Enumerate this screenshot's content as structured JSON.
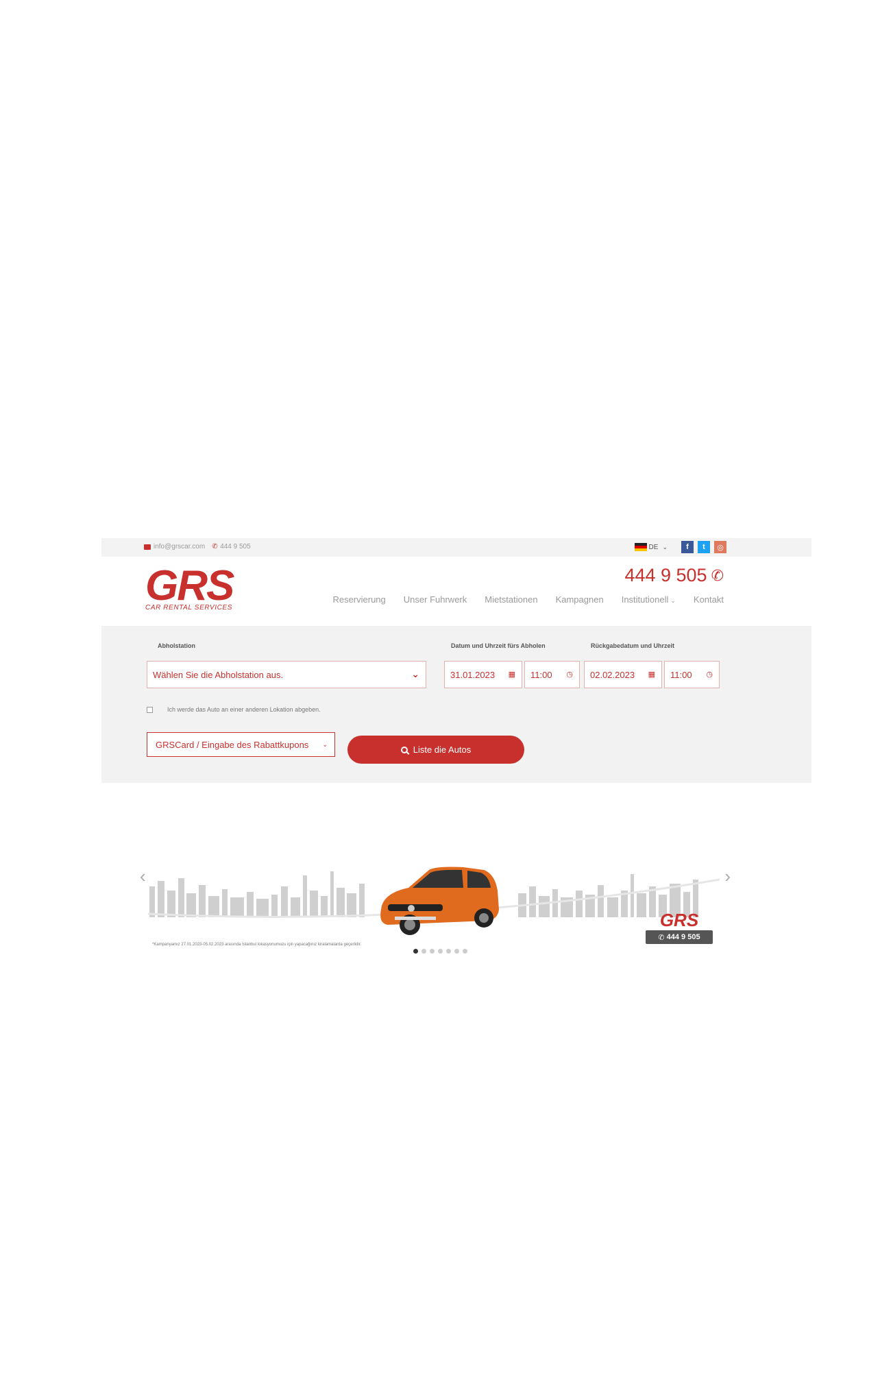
{
  "topbar": {
    "email": "info@grscar.com",
    "phone": "444 9 505",
    "language": "DE",
    "social": [
      "facebook-icon",
      "twitter-icon",
      "instagram-icon"
    ]
  },
  "header": {
    "logo_mark": "GRS",
    "logo_sub": "CAR RENTAL SERVICES",
    "hotline": "444 9 505",
    "nav": [
      "Reservierung",
      "Unser Fuhrwerk",
      "Mietstationen",
      "Kampagnen",
      "Institutionell",
      "Kontakt"
    ]
  },
  "booking": {
    "pickup_label": "Abholstation",
    "pickup_placeholder": "Wählen Sie die Abholstation aus.",
    "pickup_datetime_label": "Datum und Uhrzeit fürs Abholen",
    "pickup_date": "31.01.2023",
    "pickup_time": "11:00",
    "return_datetime_label": "Rückgabedatum und Uhrzeit",
    "return_date": "02.02.2023",
    "return_time": "11:00",
    "other_location_label": "Ich werde das Auto an einer anderen Lokation abgeben.",
    "coupon_label": "GRSCard / Eingabe des Rabattkupons",
    "search_button": "Liste die Autos"
  },
  "banner": {
    "logo_mark": "GRS",
    "phone": "444 9 505",
    "note": "*Kampanyamız 27.01.2023-05.02.2023 arasında İstanbul lokasyonumuzu için yapacağınız kiralamalarda geçerlidir.",
    "slides": 7,
    "active_slide": 1
  },
  "colors": {
    "brand": "#c8302d",
    "panel": "#f2f2f2",
    "car": "#e06a1e"
  }
}
